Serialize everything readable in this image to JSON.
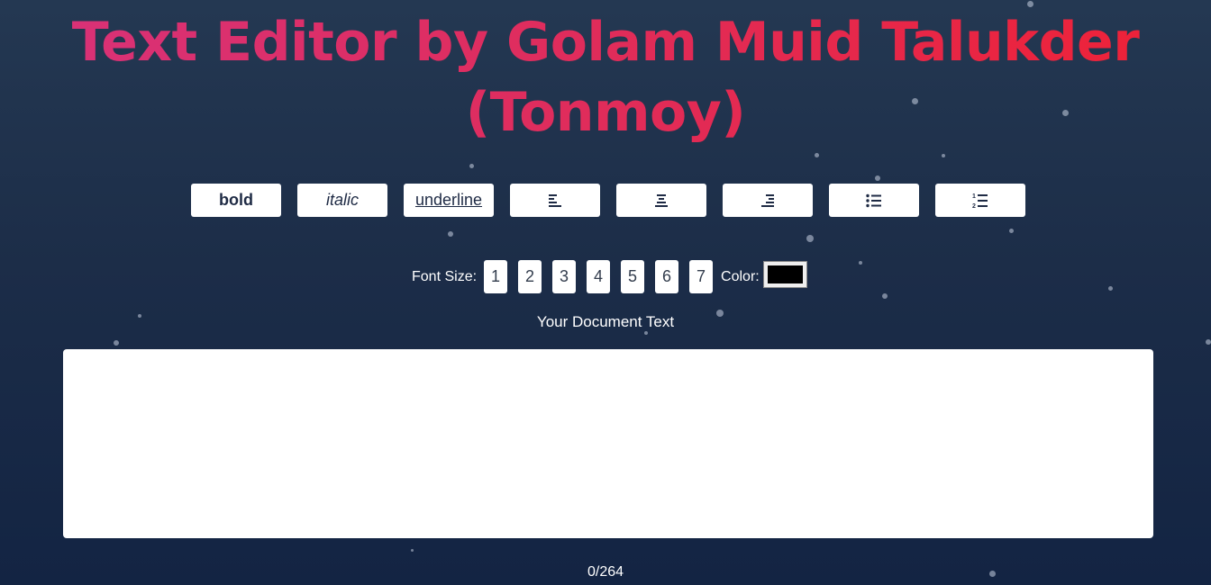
{
  "header": {
    "title_line1": "Text Editor by Golam Muid Talukder",
    "title_line2": "(Tonmoy)"
  },
  "toolbar": {
    "bold_label": "bold",
    "italic_label": "italic",
    "underline_label": "underline",
    "icons": [
      "align-left-icon",
      "align-center-icon",
      "align-right-icon",
      "bullet-list-icon",
      "numbered-list-icon"
    ]
  },
  "font": {
    "label": "Font Size:",
    "sizes": [
      "1",
      "2",
      "3",
      "4",
      "5",
      "6",
      "7"
    ]
  },
  "color": {
    "label": "Color:",
    "value": "#000000"
  },
  "document": {
    "label": "Your Document Text",
    "content": ""
  },
  "counter": {
    "text": "0/264"
  },
  "theme": {
    "title_gradient_start": "#d8327a",
    "title_gradient_end": "#ef2135",
    "background_top": "#243852",
    "background_bottom": "#132443"
  }
}
